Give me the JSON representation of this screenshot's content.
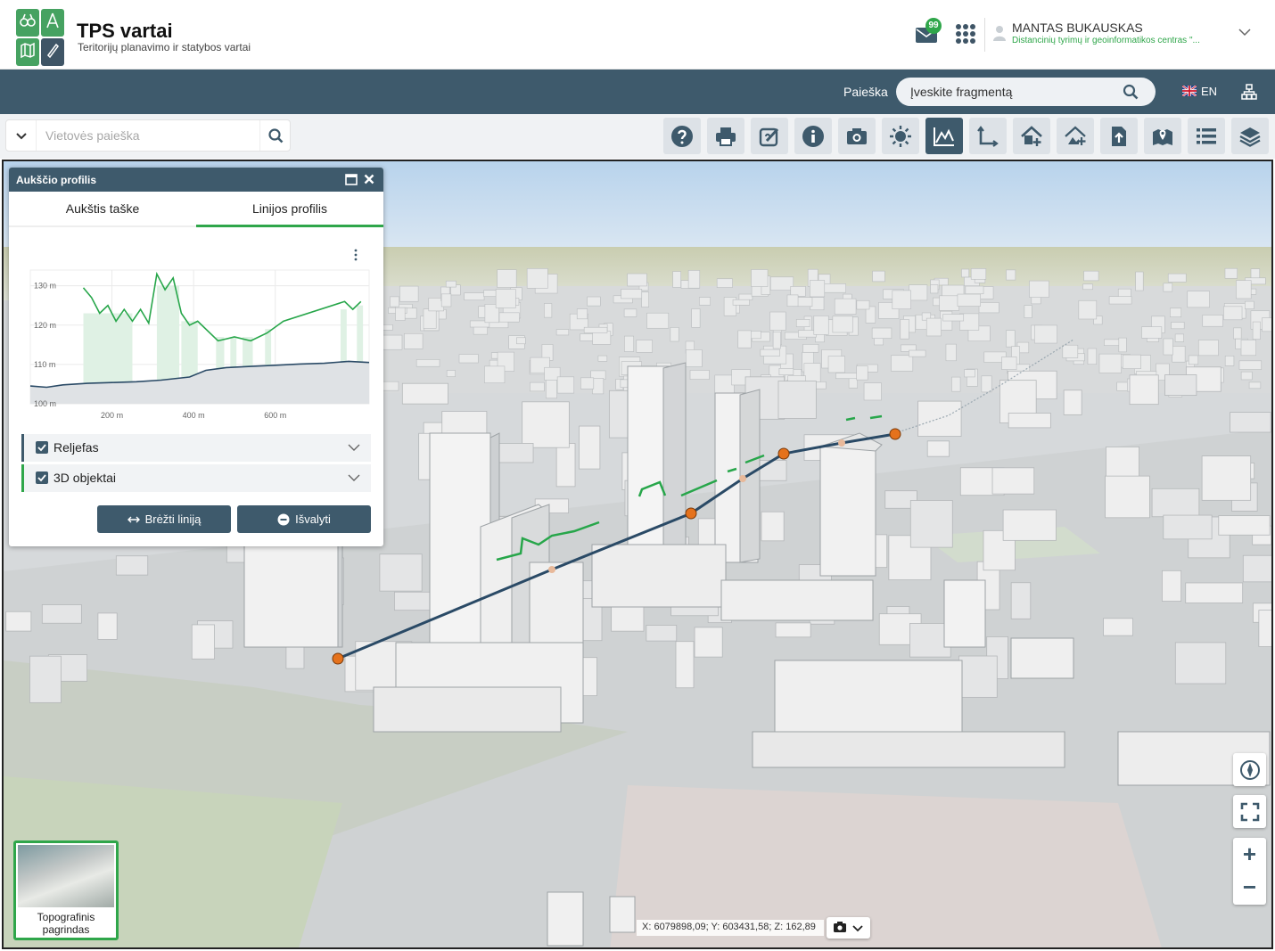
{
  "header": {
    "app_title": "TPS vartai",
    "app_subtitle": "Teritorijų planavimo ir statybos vartai",
    "mail_badge": "99",
    "user_name": "MANTAS BUKAUSKAS",
    "user_org": "Distancinių tyrimų ir geoinformatikos centras \"..."
  },
  "navbar": {
    "search_label": "Paieška",
    "search_value": "Įveskite fragmentą",
    "language": "EN"
  },
  "toolbar": {
    "location_placeholder": "Vietovės paieška",
    "tools": [
      "help-icon",
      "print-icon",
      "edit-link-icon",
      "info-icon",
      "camera-icon",
      "sun-icon",
      "elevation-profile-icon",
      "measure-icon",
      "building-add-icon",
      "terrain-add-icon",
      "upload-icon",
      "map-marker-icon",
      "list-icon",
      "layers-icon"
    ],
    "active_tool": "elevation-profile-icon"
  },
  "profile_panel": {
    "title": "Aukščio profilis",
    "tabs": [
      "Aukštis taške",
      "Linijos profilis"
    ],
    "active_tab": "Linijos profilis",
    "layers": [
      {
        "label": "Reljefas",
        "checked": true
      },
      {
        "label": "3D objektai",
        "checked": true
      }
    ],
    "draw_button": "Brėžti liniją",
    "clear_button": "Išvalyti"
  },
  "chart_data": {
    "type": "area",
    "y_ticks": [
      "130 m",
      "120 m",
      "110 m",
      "100 m"
    ],
    "x_ticks": [
      "200 m",
      "400 m",
      "600 m"
    ],
    "ylim": [
      100,
      134
    ],
    "xlim": [
      0,
      830
    ],
    "series": [
      {
        "values": [
          [
            0,
            104.5
          ],
          [
            40,
            104.2
          ],
          [
            80,
            104.8
          ],
          [
            140,
            105.2
          ],
          [
            200,
            105.4
          ],
          [
            260,
            105.6
          ],
          [
            320,
            106
          ],
          [
            390,
            106.8
          ],
          [
            430,
            108.5
          ],
          [
            480,
            109.2
          ],
          [
            540,
            109.5
          ],
          [
            600,
            109.8
          ],
          [
            660,
            110.1
          ],
          [
            720,
            110.3
          ],
          [
            780,
            110.8
          ],
          [
            830,
            110.5
          ]
        ]
      },
      {
        "values": [
          [
            130,
            129.5
          ],
          [
            150,
            127
          ],
          [
            170,
            123
          ],
          [
            190,
            125
          ],
          [
            210,
            121
          ],
          [
            230,
            124
          ],
          [
            250,
            121
          ],
          [
            270,
            124
          ],
          [
            290,
            120.5
          ],
          [
            310,
            133
          ],
          [
            330,
            129
          ],
          [
            350,
            132
          ],
          [
            370,
            123
          ],
          [
            390,
            120
          ],
          [
            410,
            121
          ],
          [
            460,
            116
          ],
          [
            500,
            117
          ],
          [
            540,
            116
          ],
          [
            580,
            118
          ],
          [
            620,
            121
          ],
          [
            770,
            126
          ],
          [
            790,
            124
          ],
          [
            810,
            126
          ]
        ]
      }
    ]
  },
  "map": {
    "basemap_label": "Topografinis pagrindas",
    "coords": "X: 6079898,09; Y: 603431,58; Z: 162,89",
    "colors": {
      "route": "#2a4a66",
      "route_points": "#e5721c",
      "buildings": "#eeeeee",
      "profile_line": "#27a64a"
    }
  }
}
